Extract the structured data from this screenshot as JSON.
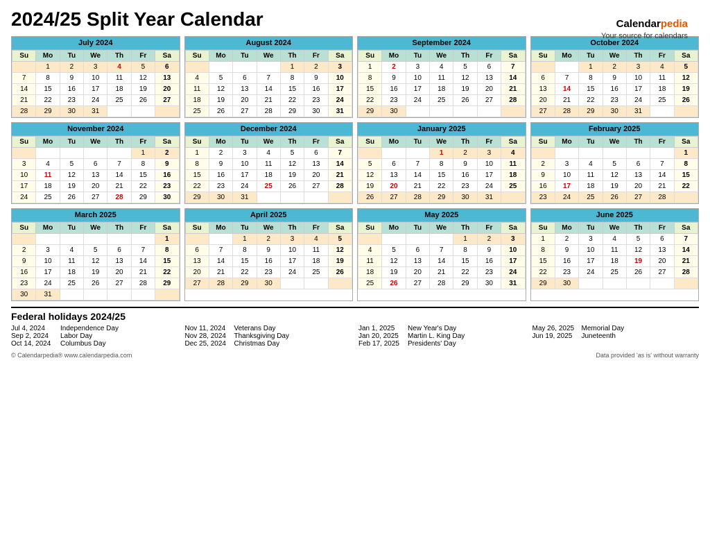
{
  "page": {
    "title": "2024/25 Split Year Calendar",
    "brand_name": "Calendar",
    "brand_accent": "pedia",
    "brand_tagline": "Your source for calendars"
  },
  "months": [
    {
      "name": "July 2024",
      "header_color": "#4db8d4",
      "days_header": [
        "Su",
        "Mo",
        "Tu",
        "We",
        "Th",
        "Fr",
        "Sa"
      ],
      "weeks": [
        [
          "",
          "1",
          "2",
          "3",
          "4",
          "5",
          "6"
        ],
        [
          "7",
          "8",
          "9",
          "10",
          "11",
          "12",
          "13"
        ],
        [
          "14",
          "15",
          "16",
          "17",
          "18",
          "19",
          "20"
        ],
        [
          "21",
          "22",
          "23",
          "24",
          "25",
          "26",
          "27"
        ],
        [
          "28",
          "29",
          "30",
          "31",
          "",
          "",
          ""
        ]
      ],
      "holidays": [
        "4"
      ],
      "shade_rows": [
        0,
        4
      ]
    },
    {
      "name": "August 2024",
      "days_header": [
        "Su",
        "Mo",
        "Tu",
        "We",
        "Th",
        "Fr",
        "Sa"
      ],
      "weeks": [
        [
          "",
          "",
          "",
          "",
          "1",
          "2",
          "3"
        ],
        [
          "4",
          "5",
          "6",
          "7",
          "8",
          "9",
          "10"
        ],
        [
          "11",
          "12",
          "13",
          "14",
          "15",
          "16",
          "17"
        ],
        [
          "18",
          "19",
          "20",
          "21",
          "22",
          "23",
          "24"
        ],
        [
          "25",
          "26",
          "27",
          "28",
          "29",
          "30",
          "31"
        ]
      ],
      "holidays": [],
      "shade_rows": [
        0
      ]
    },
    {
      "name": "September 2024",
      "days_header": [
        "Su",
        "Mo",
        "Tu",
        "We",
        "Th",
        "Fr",
        "Sa"
      ],
      "weeks": [
        [
          "1",
          "2",
          "3",
          "4",
          "5",
          "6",
          "7"
        ],
        [
          "8",
          "9",
          "10",
          "11",
          "12",
          "13",
          "14"
        ],
        [
          "15",
          "16",
          "17",
          "18",
          "19",
          "20",
          "21"
        ],
        [
          "22",
          "23",
          "24",
          "25",
          "26",
          "27",
          "28"
        ],
        [
          "29",
          "30",
          "",
          "",
          "",
          "",
          ""
        ]
      ],
      "holidays": [
        "2"
      ],
      "shade_rows": [
        4
      ]
    },
    {
      "name": "October 2024",
      "days_header": [
        "Su",
        "Mo",
        "Tu",
        "We",
        "Th",
        "Fr",
        "Sa"
      ],
      "weeks": [
        [
          "",
          "",
          "1",
          "2",
          "3",
          "4",
          "5"
        ],
        [
          "6",
          "7",
          "8",
          "9",
          "10",
          "11",
          "12"
        ],
        [
          "13",
          "14",
          "15",
          "16",
          "17",
          "18",
          "19"
        ],
        [
          "20",
          "21",
          "22",
          "23",
          "24",
          "25",
          "26"
        ],
        [
          "27",
          "28",
          "29",
          "30",
          "31",
          "",
          ""
        ]
      ],
      "holidays": [
        "14"
      ],
      "shade_rows": [
        0,
        4
      ]
    },
    {
      "name": "November 2024",
      "days_header": [
        "Su",
        "Mo",
        "Tu",
        "We",
        "Th",
        "Fr",
        "Sa"
      ],
      "weeks": [
        [
          "",
          "",
          "",
          "",
          "",
          "1",
          "2"
        ],
        [
          "3",
          "4",
          "5",
          "6",
          "7",
          "8",
          "9"
        ],
        [
          "10",
          "11",
          "12",
          "13",
          "14",
          "15",
          "16"
        ],
        [
          "17",
          "18",
          "19",
          "20",
          "21",
          "22",
          "23"
        ],
        [
          "24",
          "25",
          "26",
          "27",
          "28",
          "29",
          "30"
        ]
      ],
      "holidays": [
        "11",
        "28"
      ],
      "shade_rows": [
        0
      ]
    },
    {
      "name": "December 2024",
      "days_header": [
        "Su",
        "Mo",
        "Tu",
        "We",
        "Th",
        "Fr",
        "Sa"
      ],
      "weeks": [
        [
          "1",
          "2",
          "3",
          "4",
          "5",
          "6",
          "7"
        ],
        [
          "8",
          "9",
          "10",
          "11",
          "12",
          "13",
          "14"
        ],
        [
          "15",
          "16",
          "17",
          "18",
          "19",
          "20",
          "21"
        ],
        [
          "22",
          "23",
          "24",
          "25",
          "26",
          "27",
          "28"
        ],
        [
          "29",
          "30",
          "31",
          "",
          "",
          "",
          ""
        ]
      ],
      "holidays": [
        "25"
      ],
      "shade_rows": [
        4
      ]
    },
    {
      "name": "January 2025",
      "days_header": [
        "Su",
        "Mo",
        "Tu",
        "We",
        "Th",
        "Fr",
        "Sa"
      ],
      "weeks": [
        [
          "",
          "",
          "",
          "1",
          "2",
          "3",
          "4"
        ],
        [
          "5",
          "6",
          "7",
          "8",
          "9",
          "10",
          "11"
        ],
        [
          "12",
          "13",
          "14",
          "15",
          "16",
          "17",
          "18"
        ],
        [
          "19",
          "20",
          "21",
          "22",
          "23",
          "24",
          "25"
        ],
        [
          "26",
          "27",
          "28",
          "29",
          "30",
          "31",
          ""
        ]
      ],
      "holidays": [
        "1",
        "20"
      ],
      "shade_rows": [
        0,
        4
      ]
    },
    {
      "name": "February 2025",
      "days_header": [
        "Su",
        "Mo",
        "Tu",
        "We",
        "Th",
        "Fr",
        "Sa"
      ],
      "weeks": [
        [
          "",
          "",
          "",
          "",
          "",
          "",
          "1"
        ],
        [
          "2",
          "3",
          "4",
          "5",
          "6",
          "7",
          "8"
        ],
        [
          "9",
          "10",
          "11",
          "12",
          "13",
          "14",
          "15"
        ],
        [
          "16",
          "17",
          "18",
          "19",
          "20",
          "21",
          "22"
        ],
        [
          "23",
          "24",
          "25",
          "26",
          "27",
          "28",
          ""
        ]
      ],
      "holidays": [
        "17"
      ],
      "shade_rows": [
        0,
        4
      ]
    },
    {
      "name": "March 2025",
      "days_header": [
        "Su",
        "Mo",
        "Tu",
        "We",
        "Th",
        "Fr",
        "Sa"
      ],
      "weeks": [
        [
          "",
          "",
          "",
          "",
          "",
          "",
          "1"
        ],
        [
          "2",
          "3",
          "4",
          "5",
          "6",
          "7",
          "8"
        ],
        [
          "9",
          "10",
          "11",
          "12",
          "13",
          "14",
          "15"
        ],
        [
          "16",
          "17",
          "18",
          "19",
          "20",
          "21",
          "22"
        ],
        [
          "23",
          "24",
          "25",
          "26",
          "27",
          "28",
          "29"
        ],
        [
          "30",
          "31",
          "",
          "",
          "",
          "",
          ""
        ]
      ],
      "holidays": [],
      "shade_rows": [
        0,
        5
      ]
    },
    {
      "name": "April 2025",
      "days_header": [
        "Su",
        "Mo",
        "Tu",
        "We",
        "Th",
        "Fr",
        "Sa"
      ],
      "weeks": [
        [
          "",
          "",
          "1",
          "2",
          "3",
          "4",
          "5"
        ],
        [
          "6",
          "7",
          "8",
          "9",
          "10",
          "11",
          "12"
        ],
        [
          "13",
          "14",
          "15",
          "16",
          "17",
          "18",
          "19"
        ],
        [
          "20",
          "21",
          "22",
          "23",
          "24",
          "25",
          "26"
        ],
        [
          "27",
          "28",
          "29",
          "30",
          "",
          "",
          ""
        ]
      ],
      "holidays": [],
      "shade_rows": [
        0,
        4
      ]
    },
    {
      "name": "May 2025",
      "days_header": [
        "Su",
        "Mo",
        "Tu",
        "We",
        "Th",
        "Fr",
        "Sa"
      ],
      "weeks": [
        [
          "",
          "",
          "",
          "",
          "1",
          "2",
          "3"
        ],
        [
          "4",
          "5",
          "6",
          "7",
          "8",
          "9",
          "10"
        ],
        [
          "11",
          "12",
          "13",
          "14",
          "15",
          "16",
          "17"
        ],
        [
          "18",
          "19",
          "20",
          "21",
          "22",
          "23",
          "24"
        ],
        [
          "25",
          "26",
          "27",
          "28",
          "29",
          "30",
          "31"
        ]
      ],
      "holidays": [
        "26"
      ],
      "shade_rows": [
        0
      ]
    },
    {
      "name": "June 2025",
      "days_header": [
        "Su",
        "Mo",
        "Tu",
        "We",
        "Th",
        "Fr",
        "Sa"
      ],
      "weeks": [
        [
          "1",
          "2",
          "3",
          "4",
          "5",
          "6",
          "7"
        ],
        [
          "8",
          "9",
          "10",
          "11",
          "12",
          "13",
          "14"
        ],
        [
          "15",
          "16",
          "17",
          "18",
          "19",
          "20",
          "21"
        ],
        [
          "22",
          "23",
          "24",
          "25",
          "26",
          "27",
          "28"
        ],
        [
          "29",
          "30",
          "",
          "",
          "",
          "",
          ""
        ]
      ],
      "holidays": [
        "19"
      ],
      "shade_rows": [
        4
      ]
    }
  ],
  "federal_holidays": {
    "title": "Federal holidays 2024/25",
    "col1": [
      {
        "date": "Jul 4, 2024",
        "name": "Independence Day"
      },
      {
        "date": "Sep 2, 2024",
        "name": "Labor Day"
      },
      {
        "date": "Oct 14, 2024",
        "name": "Columbus Day"
      }
    ],
    "col2": [
      {
        "date": "Nov 11, 2024",
        "name": "Veterans Day"
      },
      {
        "date": "Nov 28, 2024",
        "name": "Thanksgiving Day"
      },
      {
        "date": "Dec 25, 2024",
        "name": "Christmas Day"
      }
    ],
    "col3": [
      {
        "date": "Jan 1, 2025",
        "name": "New Year's Day"
      },
      {
        "date": "Jan 20, 2025",
        "name": "Martin L. King Day"
      },
      {
        "date": "Feb 17, 2025",
        "name": "Presidents' Day"
      }
    ],
    "col4": [
      {
        "date": "May 26, 2025",
        "name": "Memorial Day"
      },
      {
        "date": "Jun 19, 2025",
        "name": "Juneteenth"
      }
    ]
  },
  "footer": {
    "left": "© Calendarpedia®   www.calendarpedia.com",
    "right": "Data provided 'as is' without warranty"
  }
}
